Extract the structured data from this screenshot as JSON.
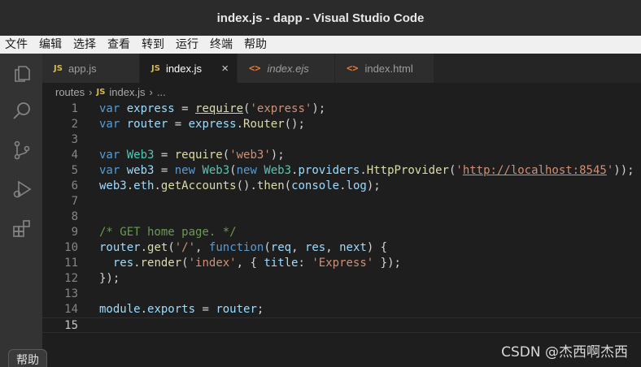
{
  "window": {
    "title": "index.js - dapp - Visual Studio Code"
  },
  "menu": [
    "文件",
    "编辑",
    "选择",
    "查看",
    "转到",
    "运行",
    "终端",
    "帮助"
  ],
  "activity_icons": [
    "explorer-icon",
    "search-icon",
    "source-control-icon",
    "run-debug-icon",
    "extensions-icon"
  ],
  "tabs": [
    {
      "badge": "JS",
      "label": "app.js"
    },
    {
      "badge": "JS",
      "label": "index.js",
      "close": "×"
    },
    {
      "badge": "<>",
      "label": "index.ejs"
    },
    {
      "badge": "<>",
      "label": "index.html"
    }
  ],
  "breadcrumb": {
    "folder": "routes",
    "sep": "›",
    "badge": "JS",
    "file": "index.js",
    "more": "..."
  },
  "editor": {
    "line_numbers": [
      "1",
      "2",
      "3",
      "4",
      "5",
      "6",
      "7",
      "8",
      "9",
      "10",
      "11",
      "12",
      "13",
      "14",
      "15"
    ],
    "current_line": 15,
    "lines": [
      [
        [
          "key",
          "var "
        ],
        [
          "var",
          "express"
        ],
        [
          "op",
          " = "
        ],
        [
          "fn",
          "require"
        ],
        [
          "op",
          "("
        ],
        [
          "str",
          "'express'"
        ],
        [
          "op",
          ");"
        ]
      ],
      [
        [
          "key",
          "var "
        ],
        [
          "var",
          "router"
        ],
        [
          "op",
          " = "
        ],
        [
          "var",
          "express"
        ],
        [
          "op",
          "."
        ],
        [
          "fn",
          "Router"
        ],
        [
          "op",
          "();"
        ]
      ],
      [],
      [
        [
          "key",
          "var "
        ],
        [
          "cls",
          "Web3"
        ],
        [
          "op",
          " = "
        ],
        [
          "fn",
          "require"
        ],
        [
          "op",
          "("
        ],
        [
          "str",
          "'web3'"
        ],
        [
          "op",
          ");"
        ]
      ],
      [
        [
          "key",
          "var "
        ],
        [
          "var",
          "web3"
        ],
        [
          "op",
          " = "
        ],
        [
          "key",
          "new "
        ],
        [
          "cls",
          "Web3"
        ],
        [
          "op",
          "("
        ],
        [
          "key",
          "new "
        ],
        [
          "cls",
          "Web3"
        ],
        [
          "op",
          "."
        ],
        [
          "var",
          "providers"
        ],
        [
          "op",
          "."
        ],
        [
          "fn",
          "HttpProvider"
        ],
        [
          "op",
          "("
        ],
        [
          "str",
          "'"
        ],
        [
          "url",
          "http://localhost:8545"
        ],
        [
          "str",
          "'"
        ],
        [
          "op",
          "));"
        ]
      ],
      [
        [
          "var",
          "web3"
        ],
        [
          "op",
          "."
        ],
        [
          "var",
          "eth"
        ],
        [
          "op",
          "."
        ],
        [
          "fn",
          "getAccounts"
        ],
        [
          "op",
          "()."
        ],
        [
          "fn",
          "then"
        ],
        [
          "op",
          "("
        ],
        [
          "var",
          "console"
        ],
        [
          "op",
          "."
        ],
        [
          "var",
          "log"
        ],
        [
          "op",
          ");"
        ]
      ],
      [],
      [],
      [
        [
          "com",
          "/* GET home page. */"
        ]
      ],
      [
        [
          "var",
          "router"
        ],
        [
          "op",
          "."
        ],
        [
          "fn",
          "get"
        ],
        [
          "op",
          "("
        ],
        [
          "str",
          "'/'"
        ],
        [
          "op",
          ", "
        ],
        [
          "key",
          "function"
        ],
        [
          "op",
          "("
        ],
        [
          "var",
          "req"
        ],
        [
          "op",
          ", "
        ],
        [
          "var",
          "res"
        ],
        [
          "op",
          ", "
        ],
        [
          "var",
          "next"
        ],
        [
          "op",
          ") {"
        ]
      ],
      [
        [
          "op",
          "  "
        ],
        [
          "var",
          "res"
        ],
        [
          "op",
          "."
        ],
        [
          "fn",
          "render"
        ],
        [
          "op",
          "("
        ],
        [
          "str",
          "'index'"
        ],
        [
          "op",
          ", { "
        ],
        [
          "var",
          "title"
        ],
        [
          "op",
          ": "
        ],
        [
          "str",
          "'Express'"
        ],
        [
          "op",
          " });"
        ]
      ],
      [
        [
          "op",
          "});"
        ]
      ],
      [],
      [
        [
          "var",
          "module"
        ],
        [
          "op",
          "."
        ],
        [
          "var",
          "exports"
        ],
        [
          "op",
          " = "
        ],
        [
          "var",
          "router"
        ],
        [
          "op",
          ";"
        ]
      ],
      []
    ]
  },
  "watermark": "CSDN @杰西啊杰西",
  "tooltip": "帮助",
  "colors": {
    "titlebar": "#2b2b2b",
    "menubar": "#f0f0f0",
    "activitybar": "#333333",
    "editor": "#1e1e1e"
  }
}
